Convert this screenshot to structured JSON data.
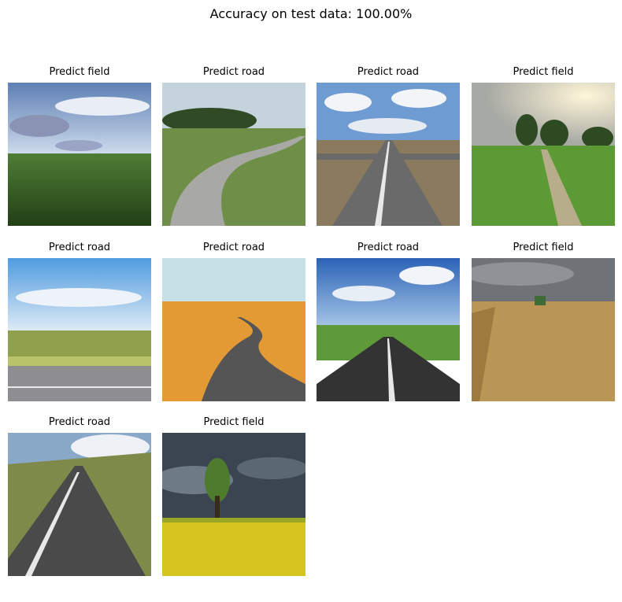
{
  "title": "Accuracy on test data: 100.00%",
  "panels": [
    {
      "label": "Predict field",
      "scene": "field-sky"
    },
    {
      "label": "Predict road",
      "scene": "curvy-road"
    },
    {
      "label": "Predict road",
      "scene": "straight-road-clouds"
    },
    {
      "label": "Predict field",
      "scene": "field-trees-path"
    },
    {
      "label": "Predict road",
      "scene": "roadside-meadow"
    },
    {
      "label": "Predict road",
      "scene": "desert-road"
    },
    {
      "label": "Predict road",
      "scene": "blue-sky-road"
    },
    {
      "label": "Predict field",
      "scene": "wheat-field-harvester"
    },
    {
      "label": "Predict road",
      "scene": "hill-road"
    },
    {
      "label": "Predict field",
      "scene": "rapeseed-field-tree"
    }
  ]
}
